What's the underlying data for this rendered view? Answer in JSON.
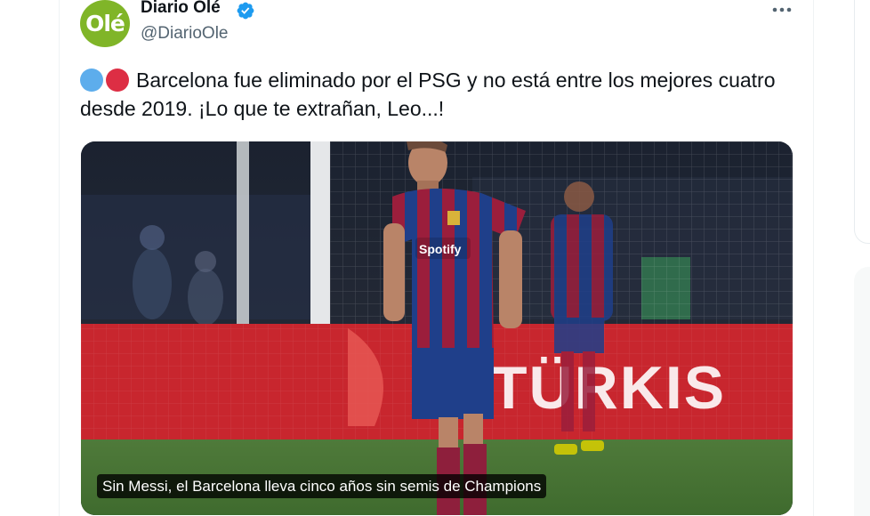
{
  "tweet": {
    "author": {
      "display_name": "Diario Olé",
      "handle": "@DiarioOle",
      "avatar_text": "Olé",
      "verified": true
    },
    "text_emojis": [
      "blue-circle",
      "red-circle"
    ],
    "text": "Barcelona fue eliminado por el PSG y no está entre los mejores cuatro desde 2019. ¡Lo que te extrañan, Leo...!",
    "media": {
      "caption": "Sin Messi, el Barcelona lleva cinco años sin semis de Champions",
      "shirt_sponsor": "Spotify",
      "board_text": "TÜRKIS"
    }
  },
  "colors": {
    "brand_green": "#80b528",
    "verified_blue": "#1d9bf0",
    "text_primary": "#0f1419",
    "text_secondary": "#536471"
  }
}
